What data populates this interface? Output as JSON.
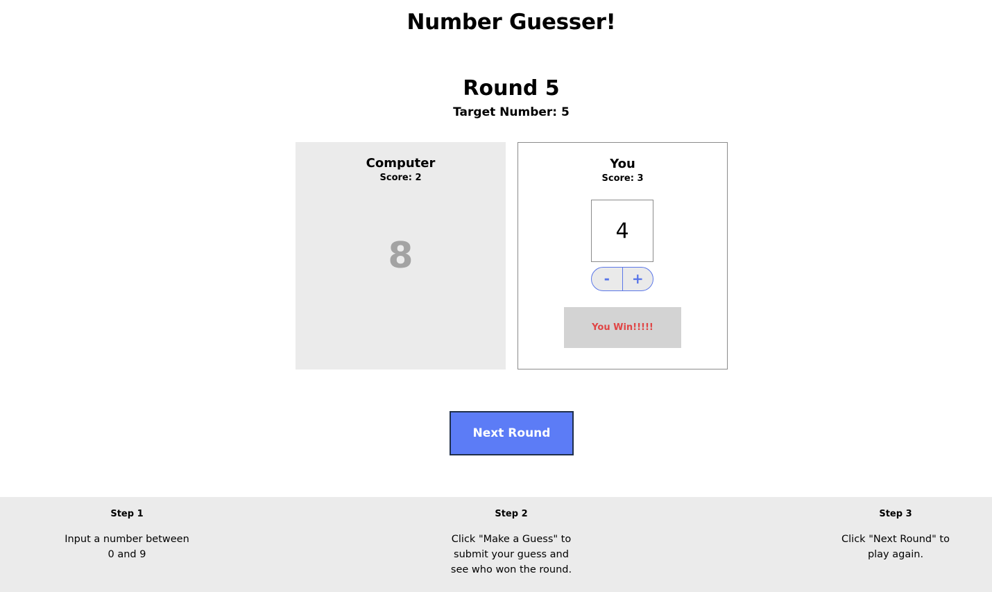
{
  "header": {
    "title": "Number Guesser!",
    "round_label": "Round 5",
    "target_label": "Target Number: 5"
  },
  "computer": {
    "name": "Computer",
    "score_label": "Score: 2",
    "guess": "8"
  },
  "player": {
    "name": "You",
    "score_label": "Score: 3",
    "guess_value": "4",
    "decrement_label": "-",
    "increment_label": "+",
    "result_message": "You Win!!!!!"
  },
  "actions": {
    "next_round_label": "Next Round"
  },
  "instructions": [
    {
      "title": "Step 1",
      "text": "Input a number between 0 and 9"
    },
    {
      "title": "Step 2",
      "text": "Click \"Make a Guess\" to submit your guess and see who won the round."
    },
    {
      "title": "Step 3",
      "text": "Click \"Next Round\" to play again."
    }
  ],
  "colors": {
    "accent": "#5c7cf6",
    "stepper_accent": "#5a76e8",
    "result_text": "#e04545",
    "panel_gray": "#ebebeb"
  }
}
